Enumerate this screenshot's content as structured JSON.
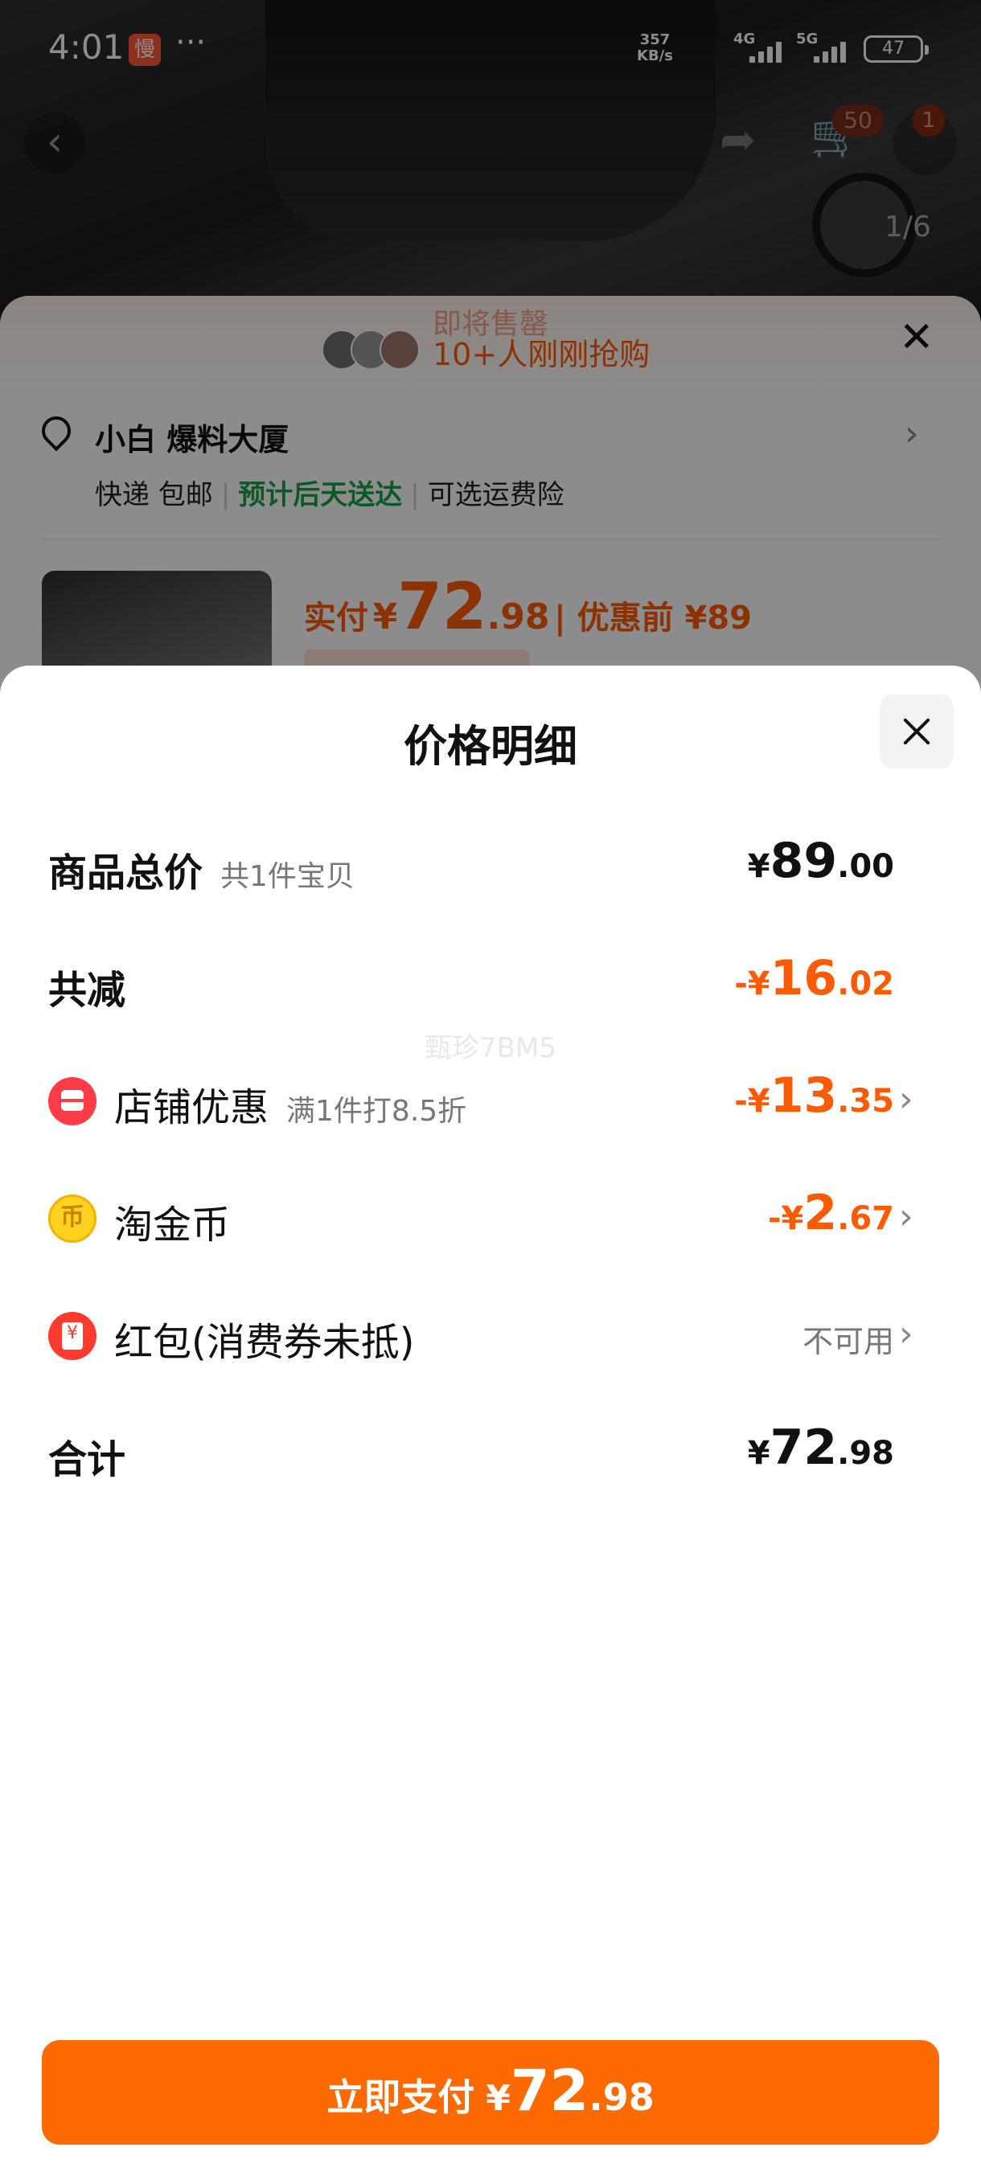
{
  "status_bar": {
    "time": "4:01",
    "app_badge": "慢",
    "more": "···",
    "speed_top": "357",
    "speed_bottom": "KB/s",
    "net1": "4G",
    "net2": "5G",
    "battery": "47"
  },
  "background": {
    "photo_counter": "1/6",
    "cart_badge": "50",
    "more_badge": "1",
    "banner_sub": "即将售罄",
    "banner_text": "10+人刚刚抢购",
    "address": "小白 爆料大厦",
    "ship": {
      "express": "快递 包邮",
      "eta": "预计后天送达",
      "insurance": "可选运费险"
    },
    "price": {
      "label": "实付",
      "yen": "¥",
      "big": "72",
      "dec": ".98",
      "orig": "| 优惠前 ¥89"
    }
  },
  "sheet": {
    "title": "价格明细",
    "watermark": "甄珍7BM5",
    "rows": [
      {
        "label": "商品总价",
        "sub": "共1件宝贝",
        "prefix": "¥",
        "big": "89",
        "dec": ".00"
      },
      {
        "label": "共减",
        "prefix": "-¥",
        "big": "16",
        "dec": ".02"
      },
      {
        "label": "店铺优惠",
        "sub": "满1件打8.5折",
        "prefix": "-¥",
        "big": "13",
        "dec": ".35",
        "icon": "shop-icon"
      },
      {
        "label": "淘金币",
        "prefix": "-¥",
        "big": "2",
        "dec": ".67",
        "icon": "coin-icon"
      },
      {
        "label": "红包(消费券未抵)",
        "value": "不可用",
        "icon": "red-packet-icon"
      },
      {
        "label": "合计",
        "prefix": "¥",
        "big": "72",
        "dec": ".98"
      }
    ],
    "pay_button": {
      "text": "立即支付",
      "prefix": "¥",
      "big": "72",
      "dec": ".98"
    }
  },
  "colors": {
    "accent": "#ff6a00",
    "discount": "#ff5a00",
    "eta_green": "#16a34a"
  }
}
